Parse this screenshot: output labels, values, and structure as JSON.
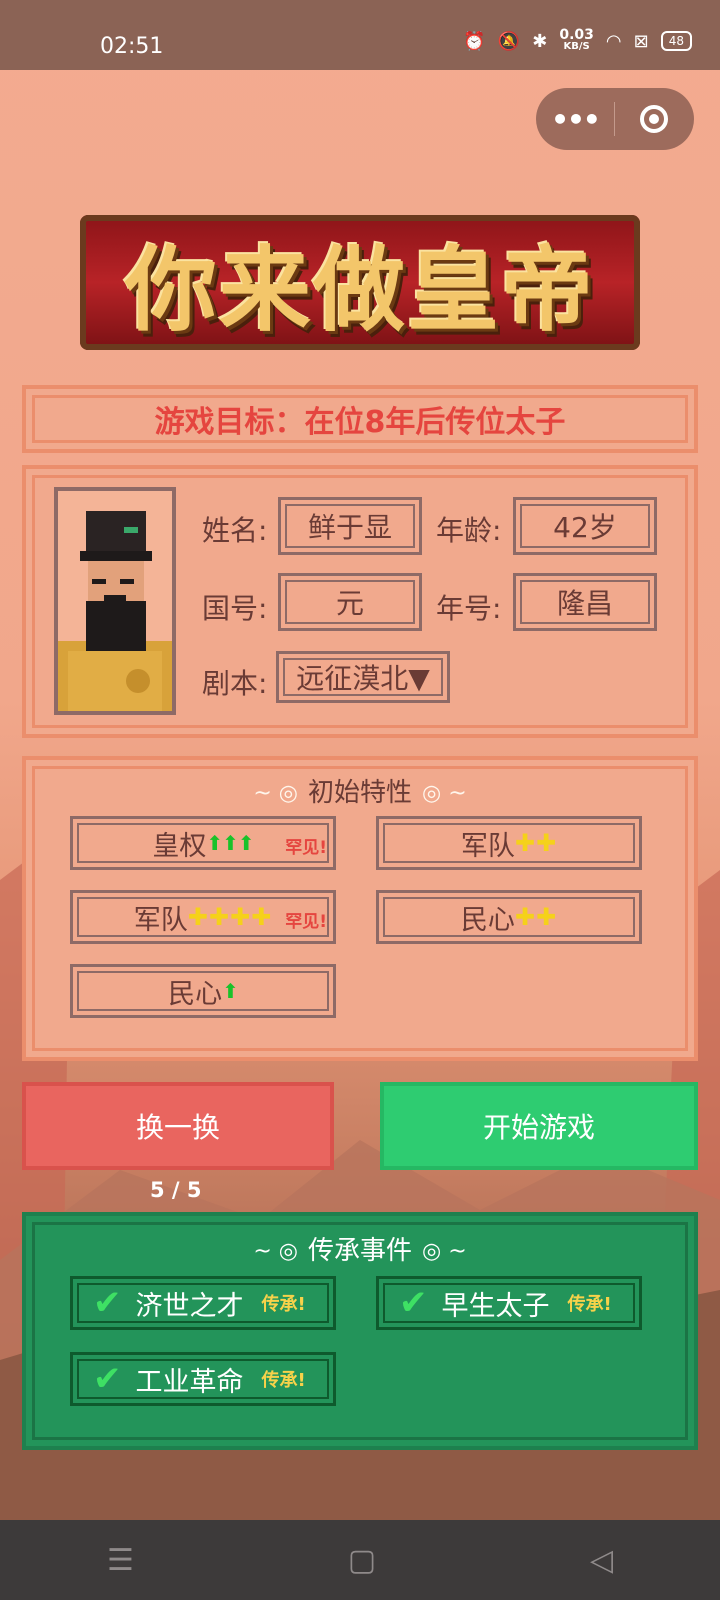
{
  "status": {
    "time": "02:51",
    "net_speed": "0.03",
    "net_unit": "KB/S",
    "battery": "48"
  },
  "title": "你来做皇帝",
  "goal": "游戏目标：在位8年后传位太子",
  "profile": {
    "name_label": "姓名:",
    "name": "鲜于显",
    "age_label": "年龄:",
    "age": "42岁",
    "country_label": "国号:",
    "country": "元",
    "era_label": "年号:",
    "era": "隆昌",
    "script_label": "剧本:",
    "script": "远征漠北▼"
  },
  "traits": {
    "title": "初始特性",
    "items": [
      {
        "name": "皇权",
        "marks": "⬆⬆⬆",
        "mark_type": "up",
        "rare": "罕见!"
      },
      {
        "name": "军队",
        "marks": "✚✚",
        "mark_type": "plus",
        "rare": ""
      },
      {
        "name": "军队",
        "marks": "✚✚✚✚",
        "mark_type": "plus",
        "rare": "罕见!"
      },
      {
        "name": "民心",
        "marks": "✚✚",
        "mark_type": "plus",
        "rare": ""
      },
      {
        "name": "民心",
        "marks": "⬆",
        "mark_type": "up",
        "rare": ""
      }
    ]
  },
  "buttons": {
    "shuffle": "换一换",
    "start": "开始游戏",
    "count": "5 / 5"
  },
  "inherit": {
    "title": "传承事件",
    "items": [
      {
        "name": "济世之才",
        "tag": "传承!"
      },
      {
        "name": "早生太子",
        "tag": "传承!"
      },
      {
        "name": "工业革命",
        "tag": "传承!"
      }
    ]
  },
  "colors": {
    "accent_red": "#e9655f",
    "accent_green": "#2ecc71",
    "panel": "#f1a98d",
    "text": "#6a3b35"
  }
}
